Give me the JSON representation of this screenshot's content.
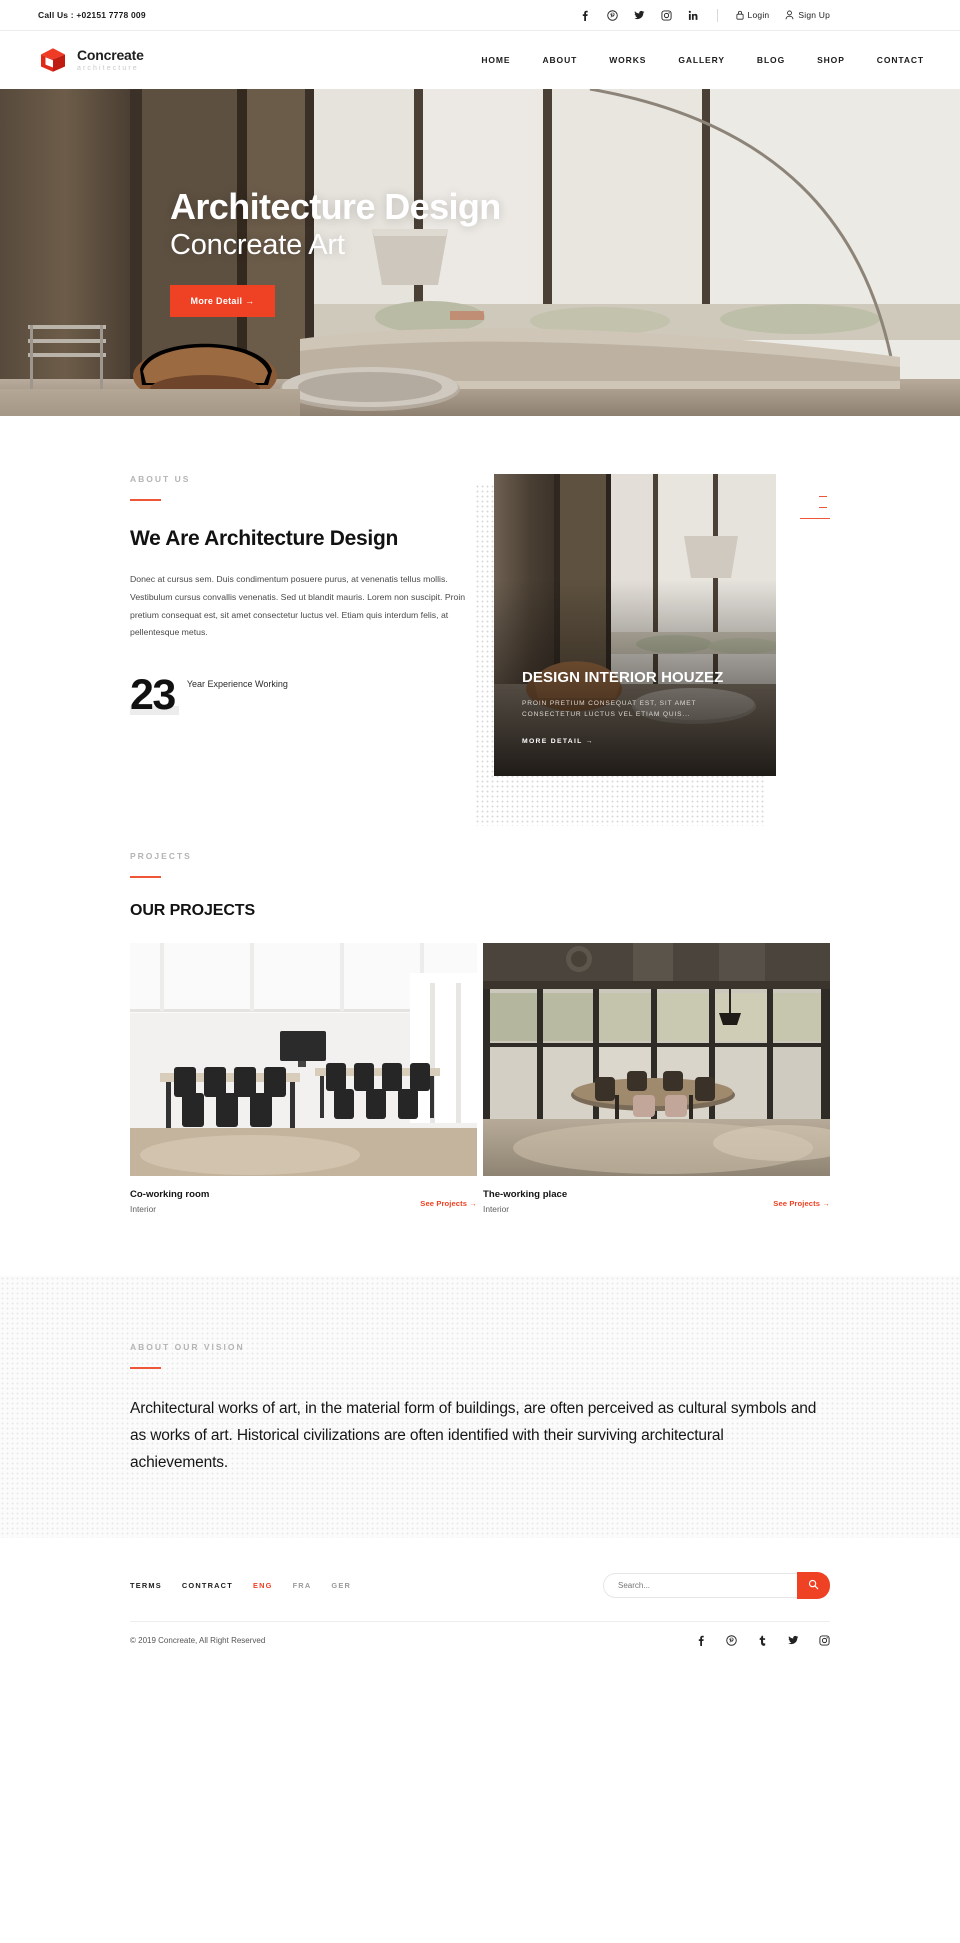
{
  "topbar": {
    "phone": "Call Us : +02151 7778 009",
    "social": [
      {
        "name": "facebook-icon",
        "glyph": "f"
      },
      {
        "name": "pinterest-icon",
        "glyph": "P"
      },
      {
        "name": "twitter-icon",
        "glyph": "t"
      },
      {
        "name": "instagram-icon",
        "glyph": "i"
      },
      {
        "name": "linkedin-icon",
        "glyph": "in"
      }
    ],
    "login_label": "Login",
    "signup_label": "Sign Up"
  },
  "brand": {
    "name": "Concreate",
    "tagline": "architecture",
    "color": "#d42a1d"
  },
  "nav": {
    "items": [
      {
        "label": "HOME"
      },
      {
        "label": "ABOUT"
      },
      {
        "label": "WORKS"
      },
      {
        "label": "GALLERY"
      },
      {
        "label": "BLOG"
      },
      {
        "label": "SHOP"
      },
      {
        "label": "CONTACT"
      }
    ]
  },
  "hero": {
    "title": "Architecture Design",
    "subtitle": "Concreate Art",
    "button_label": "More Detail →"
  },
  "about": {
    "eyebrow": "ABOUT US",
    "heading": "We Are Architecture Design",
    "paragraph": "Donec at cursus sem. Duis condimentum posuere purus, at venenatis tellus mollis. Vestibulum cursus convallis venenatis. Sed ut blandit mauris. Lorem non suscipit. Proin pretium consequat est, sit amet consectetur luctus vel. Etiam quis interdum felis, at pellentesque metus.",
    "stat_number": "23",
    "stat_label": "Year Experience Working",
    "card": {
      "heading": "DESIGN INTERIOR HOUZEZ",
      "text": "PROIN PRETIUM CONSEQUAT EST, SIT AMET CONSECTETUR LUCTUS VEL ETIAM QUIS...",
      "link_label": "MORE DETAIL →"
    }
  },
  "projects": {
    "eyebrow": "PROJECTS",
    "heading": "OUR PROJECTS",
    "items": [
      {
        "title": "Co-working room",
        "category": "Interior",
        "link_label": "See Projects →"
      },
      {
        "title": "The-working place",
        "category": "Interior",
        "link_label": "See Projects →"
      }
    ]
  },
  "vision": {
    "eyebrow": "ABOUT OUR VISION",
    "heading": "Architectural works of art, in the material form of buildings, are often perceived as cultural symbols and as works of art. Historical civilizations are often identified with their surviving architectural achievements."
  },
  "footer": {
    "links": [
      {
        "label": "TERMS"
      },
      {
        "label": "CONTRACT"
      }
    ],
    "languages": [
      {
        "label": "ENG",
        "active": true
      },
      {
        "label": "FRA",
        "active": false
      },
      {
        "label": "GER",
        "active": false
      }
    ],
    "search_placeholder": "Search...",
    "search_value": "",
    "copyright": "© 2019 Concreate, All Right Reserved",
    "social": [
      {
        "name": "facebook-icon"
      },
      {
        "name": "pinterest-icon"
      },
      {
        "name": "tumblr-icon"
      },
      {
        "name": "twitter-icon"
      },
      {
        "name": "instagram-icon"
      }
    ]
  },
  "colors": {
    "accent": "#ef4123",
    "accent_soft": "#ef5638",
    "brand_red": "#d42a1d"
  }
}
